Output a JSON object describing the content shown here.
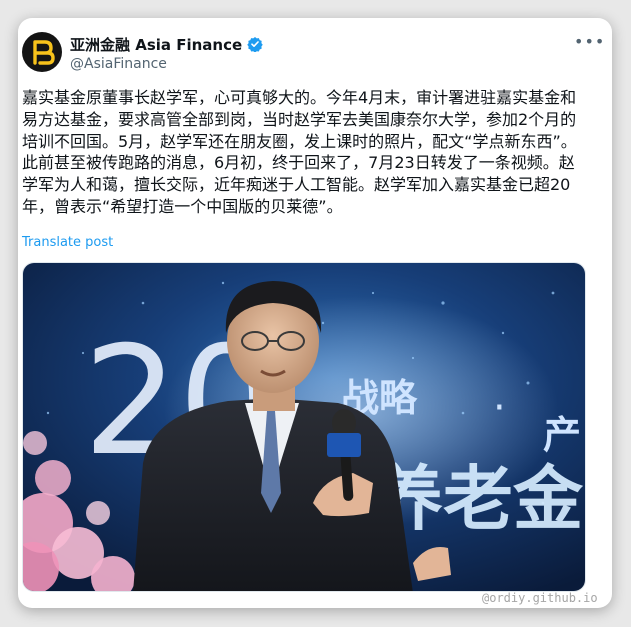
{
  "post": {
    "display_name": "亚洲金融 Asia Finance",
    "handle": "@AsiaFinance",
    "more_icon": "more-horizontal-icon",
    "verified_icon": "verified-badge-icon",
    "text": "嘉实基金原董事长赵学军，心可真够大的。今年4月末，审计署进驻嘉实基金和易方达基金，要求高管全部到岗，当时赵学军去美国康奈尔大学，参加2个月的培训不回国。5月，赵学军还在朋友圈，发上课时的照片，配文“学点新东西”。此前甚至被传跑路的消息，6月初，终于回来了，7月23日转发了一条视频。赵学军为人和蔼，擅长交际，近年痴迷于人工智能。赵学军加入嘉实基金已超20年，曾表示“希望打造一个中国版的贝莱德”。",
    "translate_label": "Translate post"
  },
  "photo": {
    "backdrop_text": {
      "year_fragment": "20",
      "slogan_left": "战略",
      "slogan_dot": "·",
      "slogan_right": "产",
      "big_chars": "养老金"
    }
  },
  "colors": {
    "link": "#1d9bf0",
    "verified": "#1d9bf0",
    "text_primary": "#0f1419",
    "text_secondary": "#536471",
    "stage_bg": "#0f2a52"
  },
  "watermark": "@ordiy.github.io"
}
